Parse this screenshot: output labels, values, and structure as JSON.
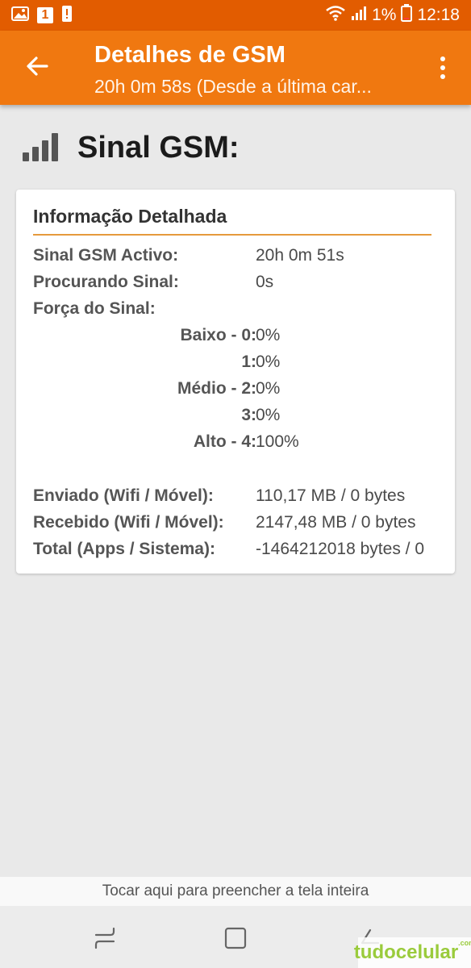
{
  "status_bar": {
    "sim_number": "1",
    "battery_percent": "1%",
    "time": "12:18",
    "icons": [
      "image-icon",
      "sim-icon",
      "alert-icon",
      "wifi-icon",
      "signal-icon",
      "battery-icon"
    ]
  },
  "app_bar": {
    "title": "Detalhes de GSM",
    "subtitle": "20h 0m 58s (Desde a última car..."
  },
  "heading": {
    "text": "Sinal GSM:"
  },
  "card": {
    "title": "Informação Detalhada",
    "active": {
      "label": "Sinal GSM Activo:",
      "value": "20h 0m 51s"
    },
    "searching": {
      "label": "Procurando Sinal:",
      "value": "0s"
    },
    "strength_label": "Força do Sinal:",
    "levels": [
      {
        "label": "Baixo - 0:",
        "value": "0%"
      },
      {
        "label": "1:",
        "value": "0%"
      },
      {
        "label": "Médio - 2:",
        "value": "0%"
      },
      {
        "label": "3:",
        "value": "0%"
      },
      {
        "label": "Alto - 4:",
        "value": "100%"
      }
    ],
    "sent": {
      "label": "Enviado (Wifi / Móvel):",
      "value": "110,17 MB / 0 bytes"
    },
    "received": {
      "label": "Recebido (Wifi / Móvel):",
      "value": "2147,48 MB / 0 bytes"
    },
    "total": {
      "label": "Total (Apps / Sistema):",
      "value": "-1464212018 bytes / 0"
    }
  },
  "footer": {
    "fill_hint": "Tocar aqui para preencher a tela inteira"
  },
  "watermark": {
    "text": "tudocelular",
    "suffix": ".com"
  },
  "colors": {
    "status_bar": "#e25c00",
    "app_bar": "#f07810",
    "accent_rule": "#e59a3c",
    "background": "#e9e9e9"
  }
}
